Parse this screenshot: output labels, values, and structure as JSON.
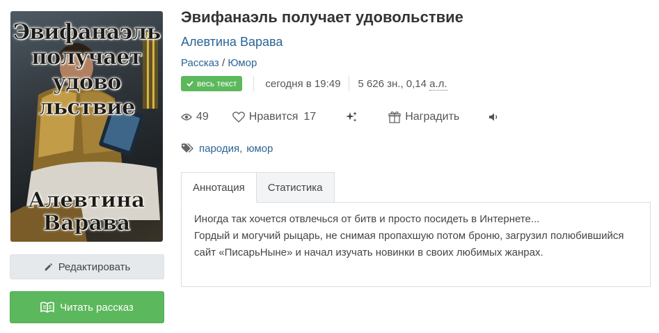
{
  "cover": {
    "title_lines": [
      "Эвифанаэль",
      "получает",
      "удово",
      "льствие"
    ],
    "author_lines": [
      "Алевтина",
      "Варава"
    ]
  },
  "book": {
    "title": "Эвифанаэль получает удовольствие",
    "author": "Алевтина Варава",
    "form": "Рассказ",
    "genre_sep": "/",
    "genre": "Юмор"
  },
  "meta": {
    "badge": "весь текст",
    "updated": "сегодня в 19:49",
    "size_chars": "5 626 зн., 0,14 ",
    "size_unit": "а.л."
  },
  "stats": {
    "views": "49",
    "likes_label": "Нравится",
    "likes": "17",
    "award_label": "Наградить"
  },
  "tags": [
    "пародия",
    "юмор"
  ],
  "tags_sep": ",",
  "tabs": [
    {
      "label": "Аннотация",
      "active": true
    },
    {
      "label": "Статистика",
      "active": false
    }
  ],
  "annotation": [
    "Иногда так хочется отвлечься от битв и просто посидеть в Интернете...",
    "Гордый и могучий рыцарь, не снимая пропахшую потом броню, загрузил полюбившийся сайт «ПисарьНыне» и начал изучать новинки в своих любимых жанрах."
  ],
  "buttons": {
    "edit": "Редактировать",
    "read": "Читать рассказ"
  },
  "colors": {
    "link": "#2a6496",
    "accent_green": "#5cb85c",
    "button_gray": "#e6e9ec"
  },
  "icons": {
    "views": "eye-icon",
    "likes": "heart-icon",
    "sparkle": "sparkles-icon",
    "award": "gift-icon",
    "audio": "speaker-icon",
    "tags": "tags-icon",
    "edit": "pencil-icon",
    "read": "book-open-icon",
    "badge": "check-icon"
  }
}
